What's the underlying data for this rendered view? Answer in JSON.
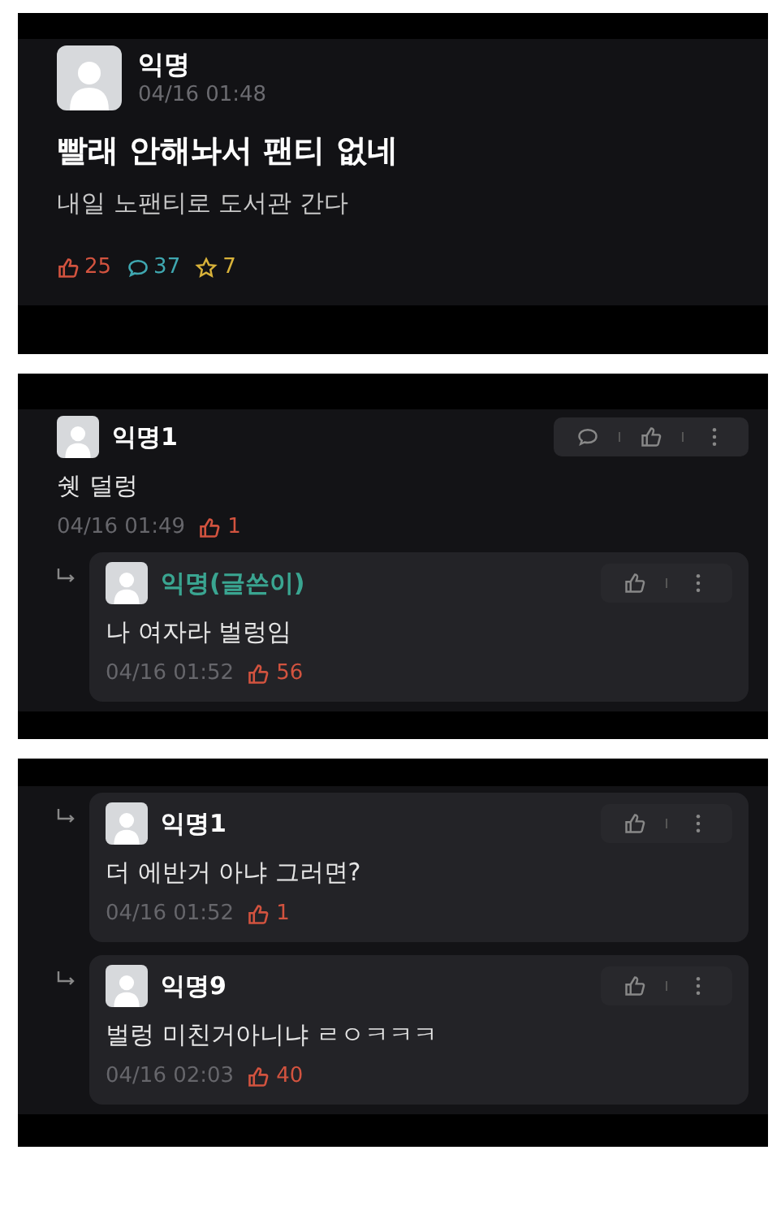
{
  "panels": [
    {
      "kind": "post",
      "author": "익명",
      "time": "04/16 01:48",
      "title": "빨래 안해놔서 팬티 없네",
      "body": "내일 노팬티로 도서관 간다",
      "likes": "25",
      "comments": "37",
      "scraps": "7"
    },
    {
      "kind": "thread",
      "comments": [
        {
          "reply": false,
          "op": false,
          "author": "익명1",
          "text": "쉣 덜렁",
          "time": "04/16 01:49",
          "likes": "1"
        },
        {
          "reply": true,
          "op": true,
          "author": "익명(글쓴이)",
          "text": "나 여자라 벌렁임",
          "time": "04/16 01:52",
          "likes": "56"
        }
      ]
    },
    {
      "kind": "thread",
      "comments": [
        {
          "reply": true,
          "op": false,
          "author": "익명1",
          "text": "더 에반거 아냐 그러면?",
          "time": "04/16 01:52",
          "likes": "1"
        },
        {
          "reply": true,
          "op": false,
          "author": "익명9",
          "text": "벌렁 미친거아니냐 ㄹㅇㅋㅋㅋ",
          "time": "04/16 02:03",
          "likes": "40"
        }
      ]
    }
  ]
}
